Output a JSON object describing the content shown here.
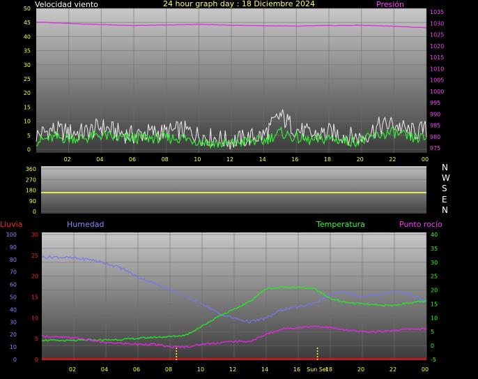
{
  "colors": {
    "wind_text": "#ffffff",
    "title_text": "#ffff66",
    "pressure_text": "#ff44ff",
    "rain_text": "#ff2222",
    "humidity_text": "#8888ff",
    "temperature_text": "#33ff33",
    "dew_text": "#ff33ff",
    "axis_text": "#ffff33",
    "wind_gust": "#f0f0f0",
    "wind_avg": "#33ee33",
    "pressure_line": "#dd33dd",
    "direction_line": "#ffff44",
    "humidity_line": "#7777ee",
    "temperature_line": "#22ee22",
    "dew_line": "#ee22ee",
    "rain_line": "#ff0000"
  },
  "x_ticks": [
    "02",
    "04",
    "06",
    "08",
    "10",
    "12",
    "14",
    "16",
    "18",
    "20",
    "22",
    "00"
  ],
  "chart_data": [
    {
      "type": "line",
      "title": "24 hour graph day : 18 Diciembre 2024",
      "left_label": "Velocidad viento",
      "right_label": "Presión",
      "ylim": [
        0,
        50
      ],
      "y_ticks": [
        0,
        5,
        10,
        15,
        20,
        25,
        30,
        35,
        40,
        45,
        50
      ],
      "y2lim": [
        975,
        1035
      ],
      "y2_ticks": [
        975,
        980,
        985,
        990,
        995,
        1000,
        1005,
        1010,
        1015,
        1020,
        1025,
        1030,
        1035
      ],
      "x": [
        0,
        1,
        2,
        3,
        4,
        5,
        6,
        7,
        8,
        9,
        10,
        11,
        12,
        13,
        14,
        15,
        16,
        17,
        18,
        19,
        20,
        21,
        22,
        23,
        24
      ],
      "series": [
        {
          "key": "gust",
          "axis": "left",
          "values": [
            5,
            7,
            6,
            6,
            8,
            6,
            5,
            6,
            6,
            7,
            5,
            4,
            3,
            4,
            5,
            12,
            7,
            5,
            6,
            5,
            4,
            8,
            9,
            6,
            7
          ]
        },
        {
          "key": "avg",
          "axis": "left",
          "values": [
            3,
            4,
            4,
            4,
            5,
            4,
            4,
            4,
            4,
            4,
            3,
            2,
            2,
            3,
            3,
            6,
            4,
            3,
            4,
            3,
            3,
            5,
            6,
            4,
            4
          ]
        },
        {
          "key": "pressure",
          "axis": "right",
          "values": [
            1030.5,
            1030.2,
            1030.0,
            1029.6,
            1029.4,
            1029.2,
            1029.0,
            1029.1,
            1029.2,
            1029.3,
            1029.5,
            1029.3,
            1029.1,
            1029.0,
            1028.9,
            1028.8,
            1028.7,
            1028.9,
            1029.0,
            1029.0,
            1029.1,
            1028.9,
            1028.7,
            1028.3,
            1028.0
          ]
        }
      ]
    },
    {
      "type": "line",
      "labels": [
        "N",
        "W",
        "S",
        "E",
        "N"
      ],
      "ylim": [
        0,
        360
      ],
      "y_ticks": [
        0,
        90,
        180,
        270,
        360
      ],
      "x": [
        0,
        24
      ],
      "series": [
        {
          "key": "direction",
          "values": [
            160,
            160
          ]
        }
      ]
    },
    {
      "type": "line",
      "rain_label": "Lluvia",
      "humidity_label": "Humedad",
      "temperature_label": "Temperatura",
      "dew_label": "Punto rocío",
      "outer_lim": [
        0,
        100
      ],
      "outer_ticks": [
        0,
        10,
        20,
        30,
        40,
        50,
        60,
        70,
        80,
        90,
        100
      ],
      "inner_lim": [
        0,
        30
      ],
      "inner_ticks": [
        0,
        5,
        10,
        15,
        20,
        25,
        30
      ],
      "right_lim": [
        -5,
        40
      ],
      "right_ticks": [
        -5,
        0,
        5,
        10,
        15,
        20,
        25,
        30,
        35,
        40
      ],
      "markers": [
        {
          "x": 8.4,
          "label": ""
        },
        {
          "x": 17.2,
          "label": "Sun Set"
        }
      ],
      "x": [
        0,
        1,
        2,
        3,
        4,
        5,
        6,
        7,
        8,
        9,
        10,
        11,
        12,
        13,
        14,
        15,
        16,
        17,
        18,
        19,
        20,
        21,
        22,
        23,
        24
      ],
      "series": [
        {
          "key": "humidity",
          "axis": "outer",
          "values": [
            82,
            82,
            81,
            80,
            77,
            73,
            66,
            61,
            56,
            50,
            45,
            37,
            33,
            30,
            33,
            40,
            42,
            45,
            52,
            54,
            50,
            52,
            55,
            52,
            46
          ]
        },
        {
          "key": "temperature",
          "axis": "right",
          "values": [
            2.0,
            1.8,
            1.8,
            2.0,
            2.0,
            2.2,
            2.6,
            3.0,
            3.2,
            3.8,
            7.0,
            10.5,
            13.0,
            16.0,
            20.5,
            21.0,
            21.0,
            20.5,
            17.0,
            15.5,
            15.0,
            14.5,
            14.5,
            15.5,
            16.0
          ]
        },
        {
          "key": "dew",
          "axis": "right",
          "values": [
            3.5,
            3.0,
            2.8,
            2.0,
            1.0,
            0.8,
            0.5,
            0.5,
            -0.5,
            -0.5,
            0.5,
            1.0,
            1.5,
            1.5,
            4.0,
            6.0,
            6.5,
            7.0,
            6.5,
            5.5,
            5.0,
            5.0,
            5.5,
            6.0,
            6.0
          ]
        },
        {
          "key": "rain",
          "axis": "inner",
          "values": [
            0,
            0,
            0,
            0,
            0,
            0,
            0,
            0,
            0,
            0,
            0,
            0,
            0,
            0,
            0,
            0,
            0,
            0,
            0,
            0,
            0,
            0,
            0,
            0,
            0
          ]
        }
      ]
    }
  ]
}
